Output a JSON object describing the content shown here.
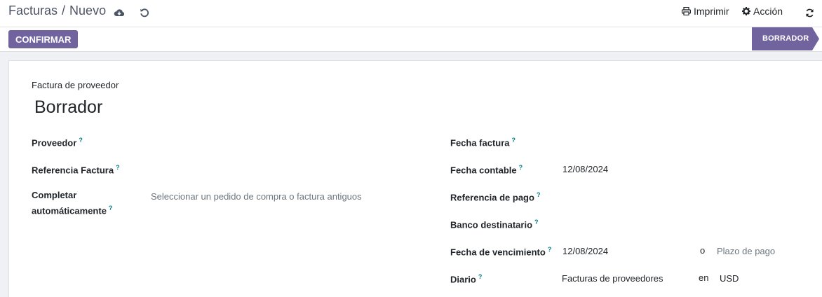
{
  "breadcrumb": {
    "parent": "Facturas",
    "separator": "/",
    "current": "Nuevo"
  },
  "toolbar": {
    "print_label": "Imprimir",
    "action_label": "Acción"
  },
  "statusbar": {
    "confirm_label": "CONFIRMAR",
    "state_label": "BORRADOR",
    "state_color": "#71639e"
  },
  "form": {
    "doc_type": "Factura de proveedor",
    "title": "Borrador",
    "help_mark": "?",
    "left_fields": {
      "vendor": {
        "label": "Proveedor",
        "value": ""
      },
      "bill_reference": {
        "label": "Referencia Factura",
        "value": ""
      },
      "autocomplete": {
        "label_line1": "Completar",
        "label_line2": "automáticamente",
        "placeholder": "Seleccionar un pedido de compra o factura antiguos"
      }
    },
    "right_fields": {
      "invoice_date": {
        "label": "Fecha factura",
        "value": ""
      },
      "accounting_date": {
        "label": "Fecha contable",
        "value": "12/08/2024"
      },
      "payment_reference": {
        "label": "Referencia de pago",
        "value": ""
      },
      "recipient_bank": {
        "label": "Banco destinatario",
        "value": ""
      },
      "due_date": {
        "label": "Fecha de vencimiento",
        "value": "12/08/2024",
        "or": "o",
        "terms_placeholder": "Plazo de pago"
      },
      "journal": {
        "label": "Diario",
        "value": "Facturas de proveedores",
        "in": "en",
        "currency": "USD"
      }
    }
  }
}
